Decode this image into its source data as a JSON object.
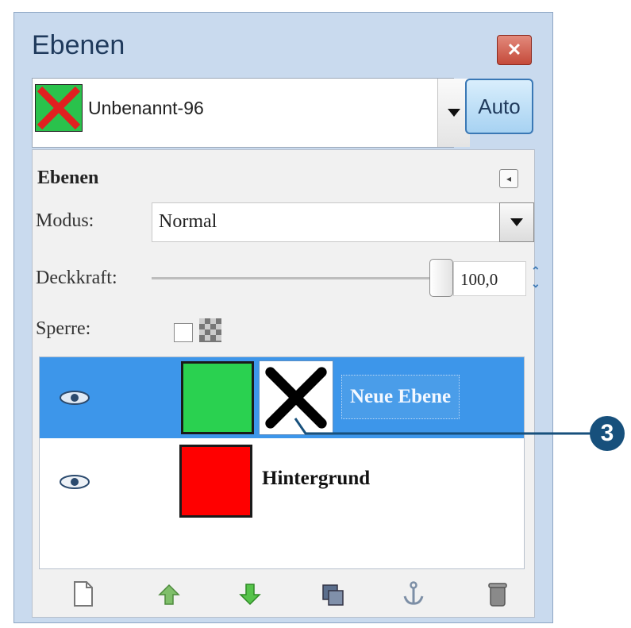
{
  "window": {
    "title": "Ebenen",
    "close_icon": "close-icon"
  },
  "image_selector": {
    "name": "Unbenannt-96",
    "thumbnail": "green square with red X",
    "auto_label": "Auto"
  },
  "dock": {
    "title": "Ebenen",
    "mode_label": "Modus:",
    "mode_value": "Normal",
    "opacity_label": "Deckkraft:",
    "opacity_value": "100,0",
    "opacity_fraction": 1.0,
    "lock_label": "Sperre:"
  },
  "layers": [
    {
      "name": "Neue Ebene",
      "selected": true,
      "visible": true,
      "color": "#2ad150",
      "has_mask": true
    },
    {
      "name": "Hintergrund",
      "selected": false,
      "visible": true,
      "color": "#ff0000",
      "has_mask": false
    }
  ],
  "toolbar": [
    "new-layer-icon",
    "raise-layer-icon",
    "lower-layer-icon",
    "duplicate-layer-icon",
    "anchor-layer-icon",
    "delete-layer-icon"
  ],
  "callout": {
    "label": "3"
  },
  "colors": {
    "selection": "#3d96ea",
    "window_bg": "#c9daee",
    "callout": "#17507c"
  }
}
